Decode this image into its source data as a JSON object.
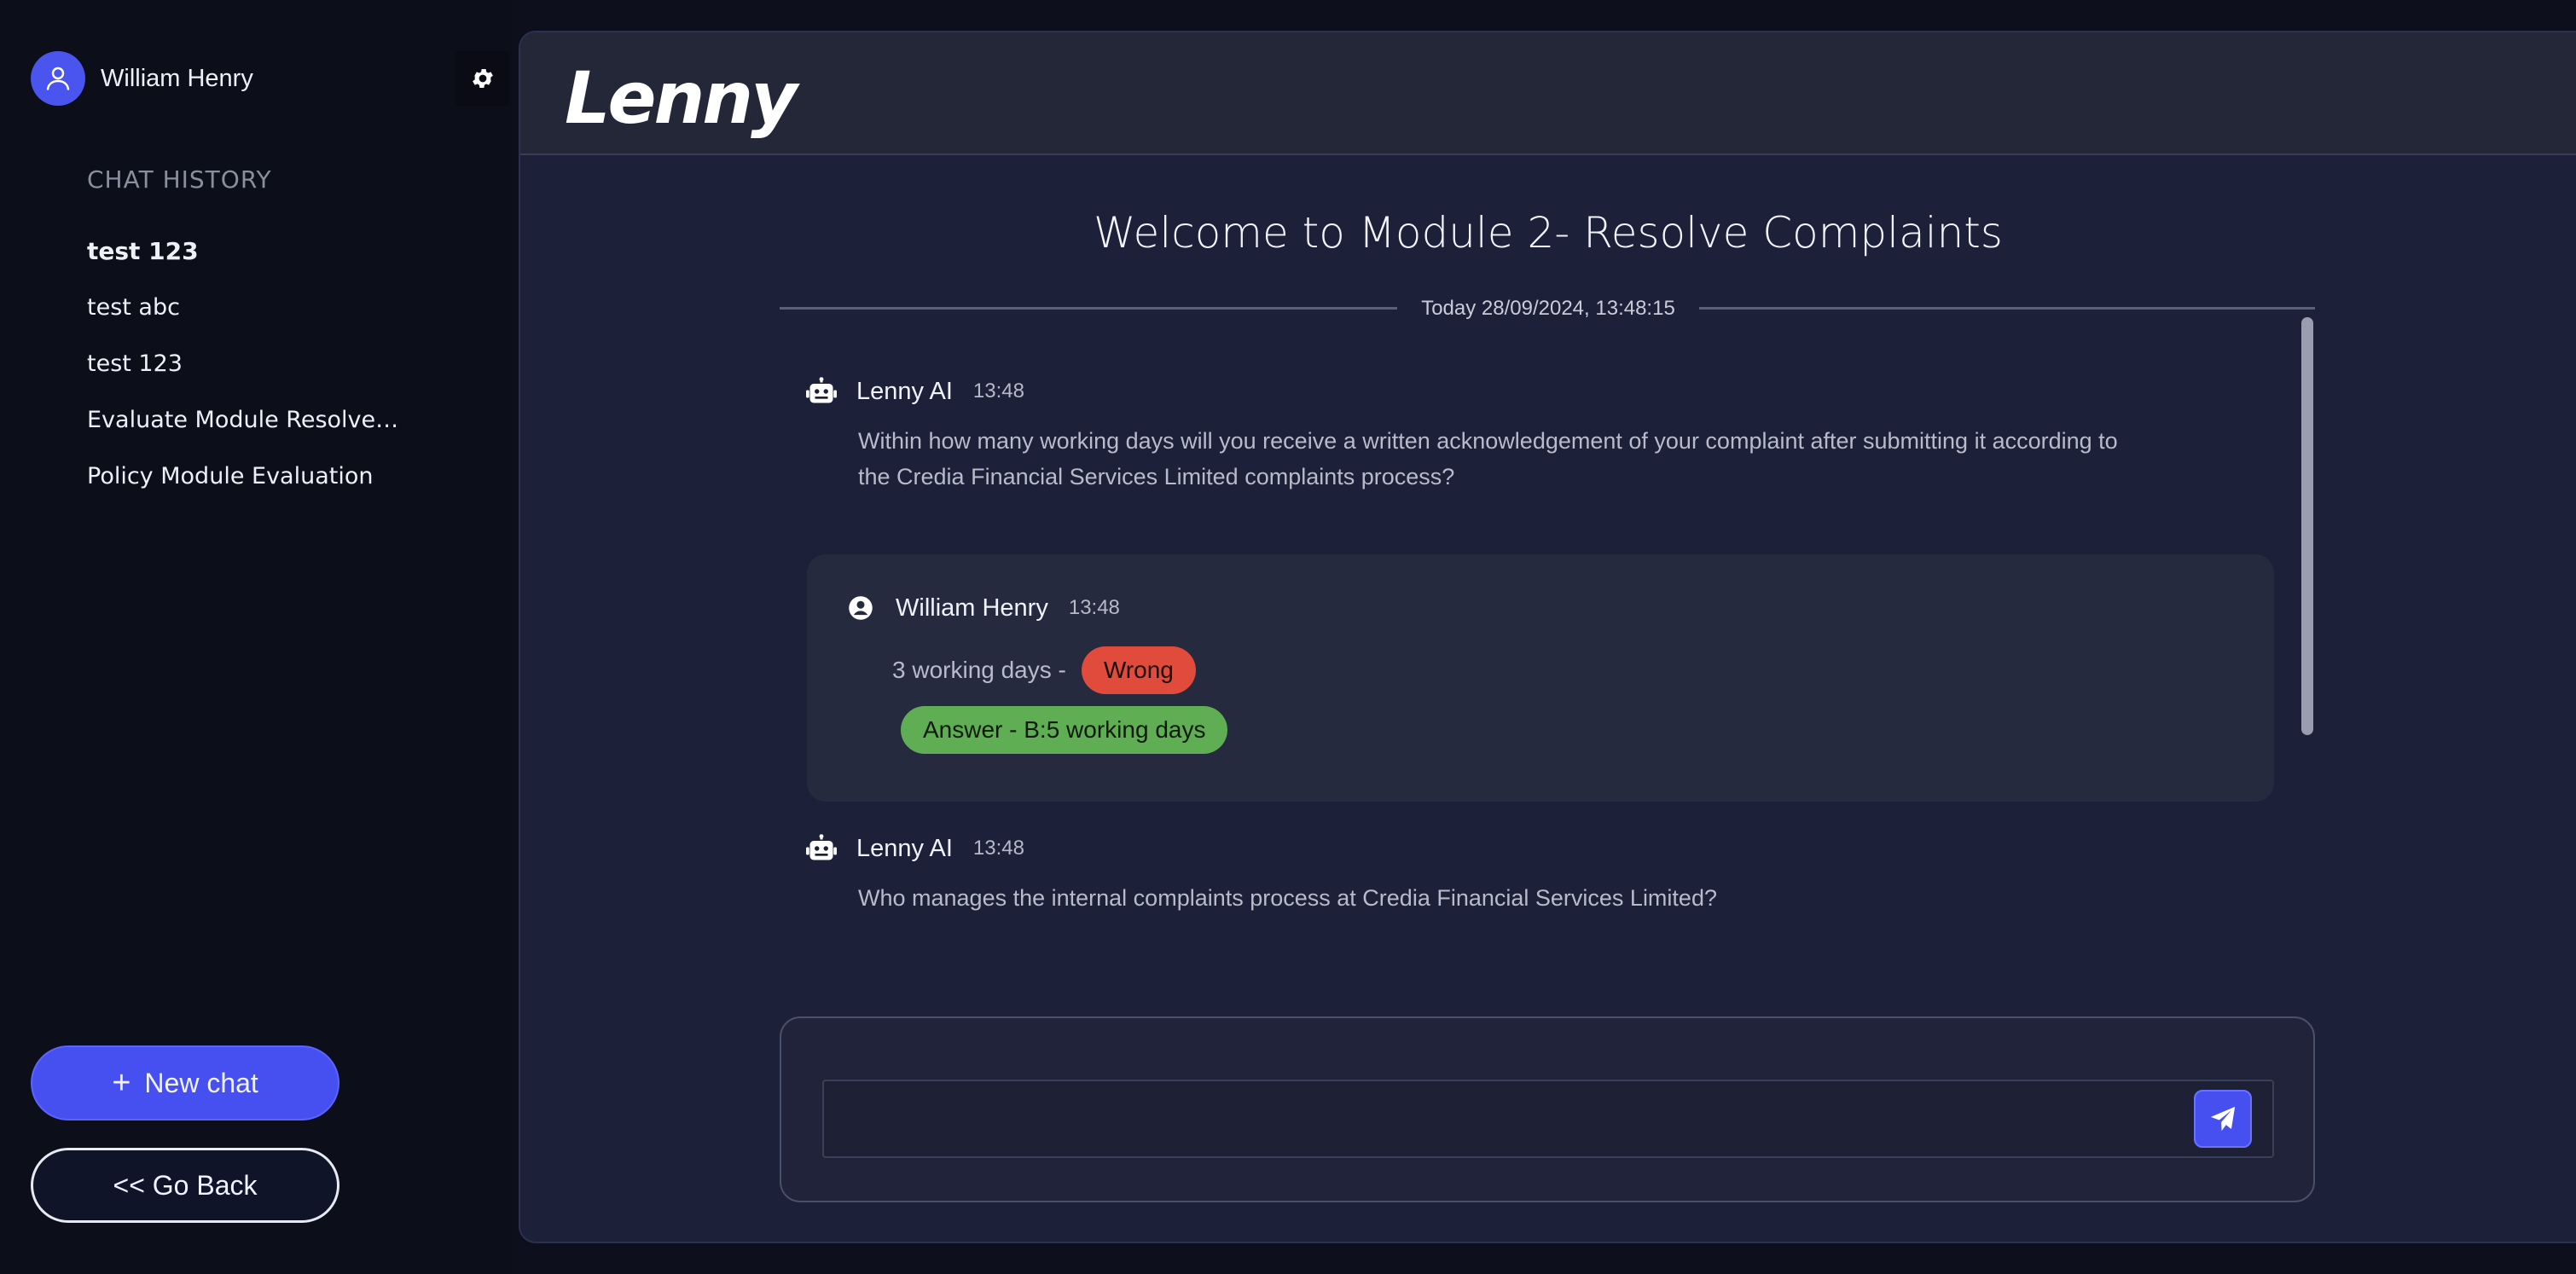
{
  "colors": {
    "accent": "#4650f0",
    "wrong": "#e04b3c",
    "correct": "#5fae54",
    "background": "#1c2038",
    "sidebar": "#0c0e1a"
  },
  "sidebar": {
    "user_name": "William Henry",
    "avatar_icon": "user-icon",
    "settings_icon": "gear-icon",
    "history_title": "CHAT HISTORY",
    "history": [
      {
        "label": "test 123"
      },
      {
        "label": "test abc"
      },
      {
        "label": "test 123"
      },
      {
        "label": "Evaluate Module Resolve ..."
      },
      {
        "label": "Policy Module Evaluation"
      }
    ],
    "new_chat_icon": "plus-icon",
    "new_chat_label": "New chat",
    "go_back_label": "<< Go Back"
  },
  "header": {
    "logo": "Lenny"
  },
  "chat": {
    "welcome": "Welcome to Module 2- Resolve Complaints",
    "date_label": "Today 28/09/2024, 13:48:15",
    "messages": [
      {
        "author": "Lenny AI",
        "time": "13:48",
        "icon": "robot-icon",
        "text_line1": "Within how many working days will you receive a written acknowledgement of your complaint after submitting it according to",
        "text_line2": "the Credia Financial Services Limited complaints process?"
      },
      {
        "author": "William Henry",
        "time": "13:48",
        "icon": "user-circle-icon",
        "answer": "3 working days -",
        "verdict": "Wrong",
        "correct_answer": "Answer - B:5 working days"
      },
      {
        "author": "Lenny AI",
        "time": "13:48",
        "icon": "robot-icon",
        "text_line1": "Who manages the internal complaints process at Credia Financial Services Limited?"
      }
    ]
  },
  "composer": {
    "value": "",
    "placeholder": "",
    "send_icon": "send-icon"
  }
}
